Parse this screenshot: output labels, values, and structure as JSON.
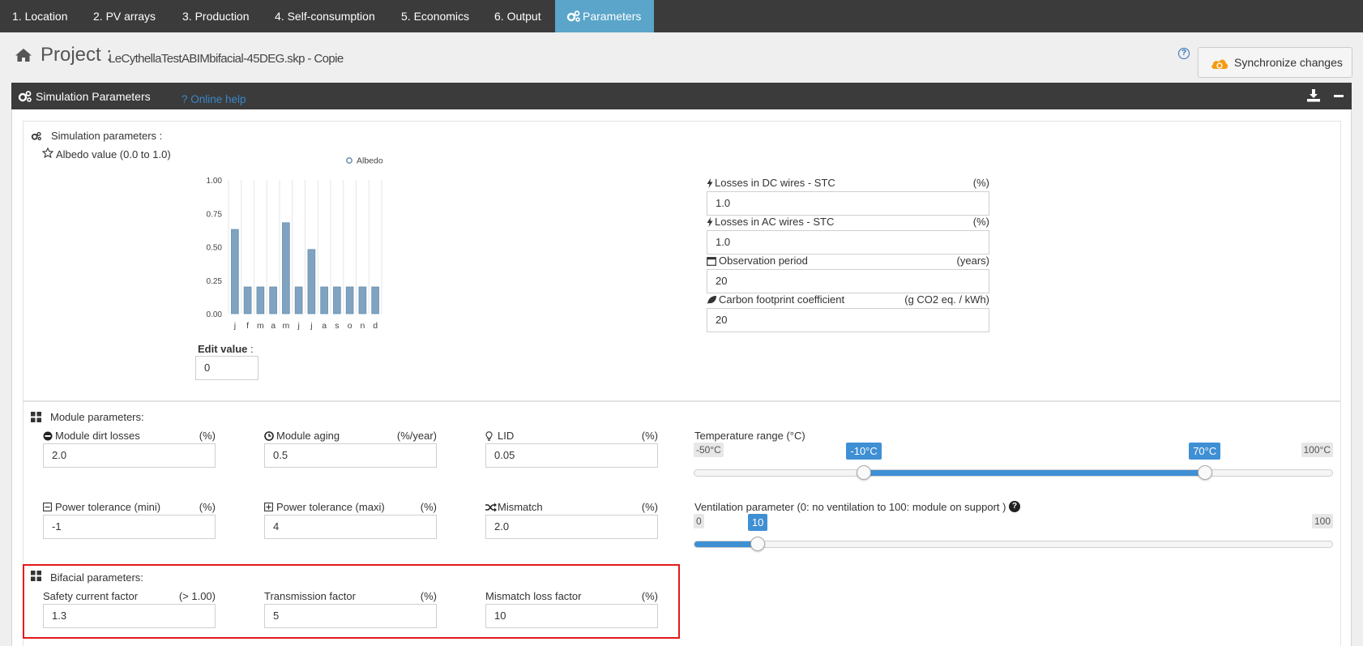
{
  "nav": {
    "tabs": [
      "1. Location",
      "2. PV arrays",
      "3. Production",
      "4. Self-consumption",
      "5. Economics",
      "6. Output",
      "Parameters"
    ]
  },
  "project": {
    "label": "Project :",
    "name": "LeCythellaTestABIMbifacial-45DEG.skp - Copie",
    "help_glyph": "?",
    "sync_label": "Synchronize changes"
  },
  "panel": {
    "title": "Simulation Parameters",
    "online_help": "? Online help"
  },
  "simulation": {
    "heading": "Simulation parameters :",
    "albedo_label": "Albedo value (0.0 to 1.0)",
    "edit_value_label": "Edit value",
    "edit_value_colon": ":",
    "edit_value": "0",
    "losses": [
      {
        "label": "Losses in DC wires - STC",
        "unit": "(%)",
        "value": "1.0",
        "icon": "bolt-icon"
      },
      {
        "label": "Losses in AC wires - STC",
        "unit": "(%)",
        "value": "1.0",
        "icon": "bolt-icon"
      },
      {
        "label": "Observation period",
        "unit": "(years)",
        "value": "20",
        "icon": "calendar-icon"
      },
      {
        "label": "Carbon footprint coefficient",
        "unit": "(g CO2 eq. / kWh)",
        "value": "20",
        "icon": "leaf-icon"
      }
    ]
  },
  "chart_data": {
    "type": "bar",
    "categories": [
      "j",
      "f",
      "m",
      "a",
      "m",
      "j",
      "j",
      "a",
      "s",
      "o",
      "n",
      "d"
    ],
    "series": [
      {
        "name": "Albedo",
        "values": [
          0.63,
          0.2,
          0.2,
          0.2,
          0.68,
          0.2,
          0.48,
          0.2,
          0.2,
          0.2,
          0.2,
          0.2
        ]
      }
    ],
    "yticks": [
      "1.00",
      "0.75",
      "0.50",
      "0.25",
      "0.00"
    ],
    "ylim": [
      0,
      1
    ],
    "grid": true,
    "legend": "top-right",
    "bar_color": "#7fa3c0"
  },
  "module": {
    "heading": "Module parameters:",
    "fields": [
      {
        "label": "Module dirt losses",
        "unit": "(%)",
        "value": "2.0",
        "icon": "minus-circle-icon"
      },
      {
        "label": "Module aging",
        "unit": "(%/year)",
        "value": "0.5",
        "icon": "clock-icon"
      },
      {
        "label": "LID",
        "unit": "(%)",
        "value": "0.05",
        "icon": "lightbulb-icon"
      },
      {
        "label": "Power tolerance (mini)",
        "unit": "(%)",
        "value": "-1",
        "icon": "minus-square-icon"
      },
      {
        "label": "Power tolerance (maxi)",
        "unit": "(%)",
        "value": "4",
        "icon": "plus-square-icon"
      },
      {
        "label": "Mismatch",
        "unit": "(%)",
        "value": "2.0",
        "icon": "shuffle-icon"
      }
    ],
    "temperature": {
      "label": "Temperature range (°C)",
      "min_label": "-50°C",
      "max_label": "100°C",
      "low_label": "-10°C",
      "high_label": "70°C",
      "min": -50,
      "max": 100,
      "low": -10,
      "high": 70
    },
    "ventilation": {
      "label": "Ventilation parameter (0: no ventilation to 100: module on support )",
      "min_label": "0",
      "max_label": "100",
      "value_label": "10",
      "min": 0,
      "max": 100,
      "value": 10
    }
  },
  "bifacial": {
    "heading": "Bifacial parameters:",
    "fields": [
      {
        "label": "Safety current factor",
        "unit": "(> 1.00)",
        "value": "1.3"
      },
      {
        "label": "Transmission factor",
        "unit": "(%)",
        "value": "5"
      },
      {
        "label": "Mismatch loss factor",
        "unit": "(%)",
        "value": "10"
      }
    ]
  },
  "colors": {
    "accent": "#5aa5c9",
    "slider": "#3f8fd4",
    "highlight": "#e31b1b",
    "dark_bar": "#3b3b3b"
  }
}
